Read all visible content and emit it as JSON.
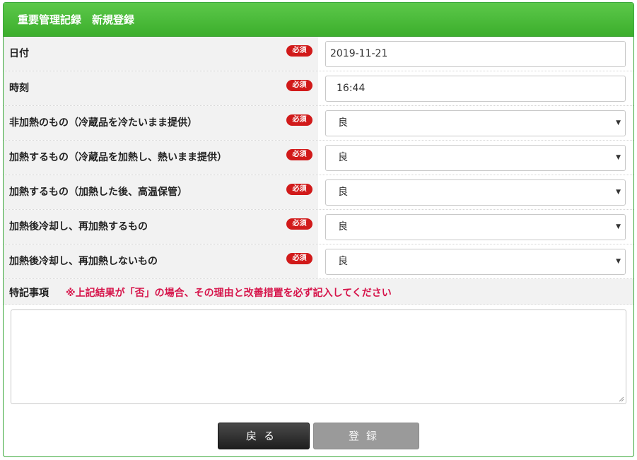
{
  "header": {
    "title": "重要管理記録　新規登録"
  },
  "required_badge": "必須",
  "rows": [
    {
      "label": "日付",
      "value": "2019-11-21"
    },
    {
      "label": "時刻",
      "value": "16:44"
    },
    {
      "label": "非加熱のもの（冷蔵品を冷たいまま提供）",
      "value": "良"
    },
    {
      "label": "加熱するもの（冷蔵品を加熱し、熱いまま提供）",
      "value": "良"
    },
    {
      "label": "加熱するもの（加熱した後、高温保管）",
      "value": "良"
    },
    {
      "label": "加熱後冷却し、再加熱するもの",
      "value": "良"
    },
    {
      "label": "加熱後冷却し、再加熱しないもの",
      "value": "良"
    }
  ],
  "notes": {
    "label": "特記事項",
    "warning": "※上記結果が「否」の場合、その理由と改善措置を必ず記入してください",
    "value": ""
  },
  "buttons": {
    "back": "戻る",
    "submit": "登録"
  },
  "icons": {
    "select_caret": "caret-down-icon",
    "resize": "resize-grip-icon"
  }
}
